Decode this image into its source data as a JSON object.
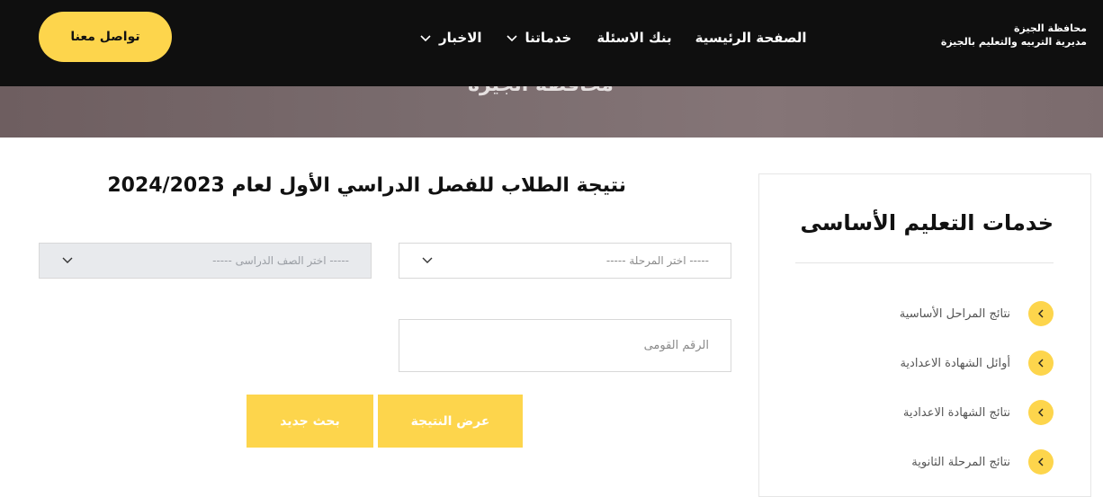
{
  "header": {
    "logo_line1": "محافظة الجيزة",
    "logo_line2": "مديرية التربيه والتعليم بالجيزة",
    "nav": [
      {
        "label": "الصفحة الرئيسية",
        "has_dropdown": false
      },
      {
        "label": "بنك الاسئلة",
        "has_dropdown": false
      },
      {
        "label": "خدماتنا",
        "has_dropdown": true
      },
      {
        "label": "الاخبار",
        "has_dropdown": true
      }
    ],
    "contact_label": "تواصل معنا"
  },
  "banner": {
    "title": "محافظة الجيزة"
  },
  "main": {
    "heading": "نتيجة الطلاب للفصل الدراسي الأول لعام 2024/2023",
    "stage_select": "----- اختر المرحلة -----",
    "grade_select": "----- اختر الصف الدراسى -----",
    "national_id_placeholder": "الرقم القومى",
    "show_result_label": "عرض النتيجة",
    "new_search_label": "بحث جديد"
  },
  "sidebar": {
    "title": "خدمات التعليم الأساسى",
    "items": [
      {
        "label": "نتائج المراحل الأساسية"
      },
      {
        "label": "أوائل الشهادة الاعدادية"
      },
      {
        "label": "نتائج الشهادة الاعدادية"
      },
      {
        "label": "نتائج المرحلة الثانوية"
      }
    ]
  },
  "colors": {
    "accent": "#fdd54c",
    "header_bg": "#0f0f0f"
  }
}
